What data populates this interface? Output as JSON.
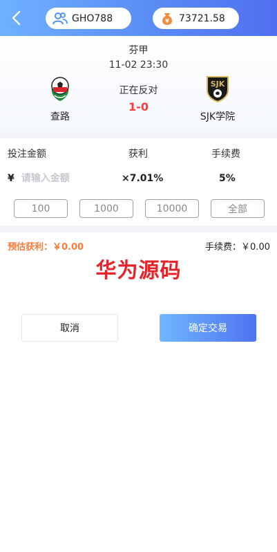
{
  "header": {
    "username": "GHO788",
    "balance": "73721.58"
  },
  "match": {
    "league": "芬甲",
    "time": "11-02 23:30",
    "status": "正在反对",
    "score": "1-0",
    "home_team": "查路",
    "away_team": "SJK学院",
    "away_logo_text": "SJK"
  },
  "bet": {
    "amount_label": "投注金额",
    "profit_label": "获利",
    "fee_label": "手续费",
    "currency": "¥",
    "amount_placeholder": "请输入金额",
    "profit_rate": "×7.01%",
    "fee_rate": "5%",
    "quick_amounts": [
      "100",
      "1000",
      "10000",
      "全部"
    ]
  },
  "summary": {
    "estimate": "预估获利：￥0.00",
    "fee": "手续费：￥0.00"
  },
  "watermark": "华为源码",
  "actions": {
    "cancel": "取消",
    "confirm": "确定交易"
  },
  "colors": {
    "accent": "#5a8cf5",
    "score": "#ff3b3b",
    "estimate": "#ff7a3a",
    "watermark": "#e6232a"
  }
}
